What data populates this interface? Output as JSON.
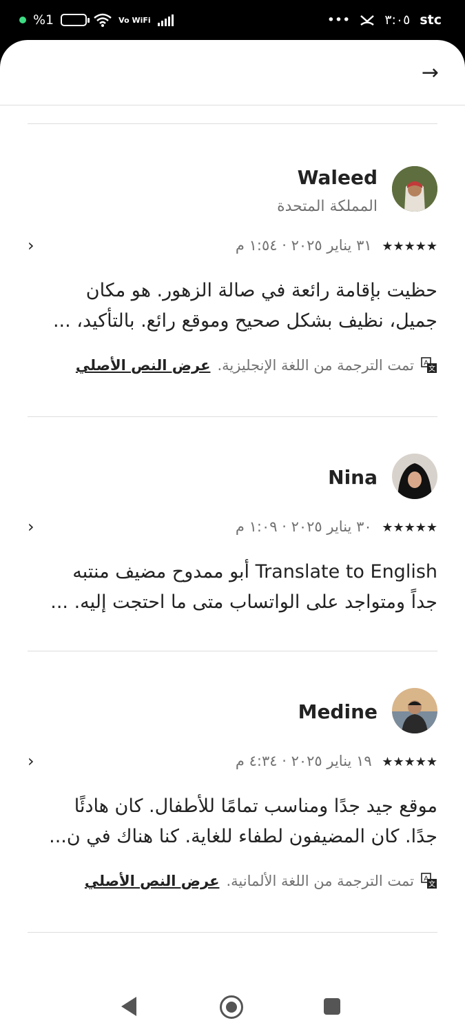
{
  "status_bar": {
    "left_battery_text": "%1",
    "wifi_label": "Vo WiFi",
    "time": "٣:٠٥",
    "carrier": "stc"
  },
  "reviews": [
    {
      "name": "Waleed",
      "location": "المملكة المتحدة",
      "stars": "★★★★★",
      "date": "٣١ يناير ٢٠٢٥ · ١:٥٤ م",
      "body_line1": "حظيت بإقامة رائعة في صالة الزهور. هو مكان",
      "body_line2": "جميل، نظيف بشكل صحيح وموقع رائع. بالتأكيد، ...",
      "translated_note": "تمت الترجمة من اللغة الإنجليزية.",
      "show_original": "عرض النص الأصلي"
    },
    {
      "name": "Nina",
      "stars": "★★★★★",
      "date": "٣٠ يناير ٢٠٢٥ · ١:٠٩ م",
      "body_line1": "Translate to English أبو ممدوح مضيف منتبه",
      "body_line2": "جداً ومتواجد على الواتساب متى ما احتجت إليه. ..."
    },
    {
      "name": "Medine",
      "stars": "★★★★★",
      "date": "١٩ يناير ٢٠٢٥ · ٤:٣٤ م",
      "body_line1": "موقع جيد جدًا ومناسب تمامًا للأطفال. كان هادئًا",
      "body_line2": "جدًا. كان المضيفون لطفاء للغاية. كنا هناك في ن...",
      "translated_note": "تمت الترجمة من اللغة الألمانية.",
      "show_original": "عرض النص الأصلي"
    }
  ]
}
